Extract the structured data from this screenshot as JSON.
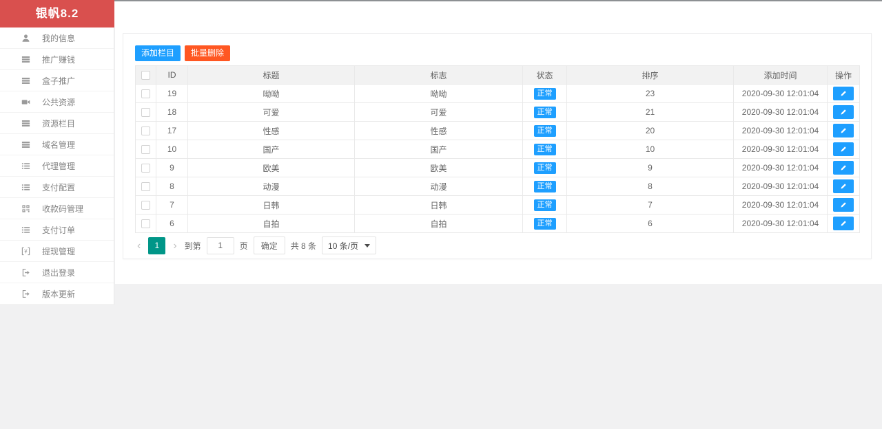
{
  "app": {
    "title": "银帆8.2"
  },
  "colors": {
    "brand_red": "#d9504e",
    "primary_blue": "#1E9FFF",
    "danger_orange": "#FF5722",
    "pagination_green": "#009688"
  },
  "sidebar": {
    "items": [
      {
        "label": "我的信息",
        "icon": "user-icon"
      },
      {
        "label": "推广赚钱",
        "icon": "table-icon"
      },
      {
        "label": "盒子推广",
        "icon": "table-icon"
      },
      {
        "label": "公共资源",
        "icon": "video-camera-icon"
      },
      {
        "label": "资源栏目",
        "icon": "table-icon"
      },
      {
        "label": "域名管理",
        "icon": "table-icon"
      },
      {
        "label": "代理管理",
        "icon": "list-icon"
      },
      {
        "label": "支付配置",
        "icon": "list-icon"
      },
      {
        "label": "收款码管理",
        "icon": "qrcode-icon"
      },
      {
        "label": "支付订单",
        "icon": "list-icon"
      },
      {
        "label": "提现管理",
        "icon": "withdraw-icon"
      },
      {
        "label": "退出登录",
        "icon": "logout-icon"
      },
      {
        "label": "版本更新",
        "icon": "logout-icon"
      }
    ]
  },
  "toolbar": {
    "add_label": "添加栏目",
    "delete_label": "批量删除"
  },
  "table": {
    "headers": [
      "ID",
      "标题",
      "标志",
      "状态",
      "排序",
      "添加时间",
      "操作"
    ],
    "rows": [
      {
        "id": "19",
        "title": "呦呦",
        "flag": "呦呦",
        "status": "正常",
        "sort": "23",
        "time": "2020-09-30 12:01:04"
      },
      {
        "id": "18",
        "title": "可爱",
        "flag": "可爱",
        "status": "正常",
        "sort": "21",
        "time": "2020-09-30 12:01:04"
      },
      {
        "id": "17",
        "title": "性感",
        "flag": "性感",
        "status": "正常",
        "sort": "20",
        "time": "2020-09-30 12:01:04"
      },
      {
        "id": "10",
        "title": "国产",
        "flag": "国产",
        "status": "正常",
        "sort": "10",
        "time": "2020-09-30 12:01:04"
      },
      {
        "id": "9",
        "title": "欧美",
        "flag": "欧美",
        "status": "正常",
        "sort": "9",
        "time": "2020-09-30 12:01:04"
      },
      {
        "id": "8",
        "title": "动漫",
        "flag": "动漫",
        "status": "正常",
        "sort": "8",
        "time": "2020-09-30 12:01:04"
      },
      {
        "id": "7",
        "title": "日韩",
        "flag": "日韩",
        "status": "正常",
        "sort": "7",
        "time": "2020-09-30 12:01:04"
      },
      {
        "id": "6",
        "title": "自拍",
        "flag": "自拍",
        "status": "正常",
        "sort": "6",
        "time": "2020-09-30 12:01:04"
      }
    ]
  },
  "pagination": {
    "prev": "‹",
    "current_page": "1",
    "next": "›",
    "goto_prefix": "到第",
    "goto_value": "1",
    "goto_suffix": "页",
    "confirm_label": "确定",
    "total_label": "共 8 条",
    "per_page_label": "10 条/页"
  }
}
